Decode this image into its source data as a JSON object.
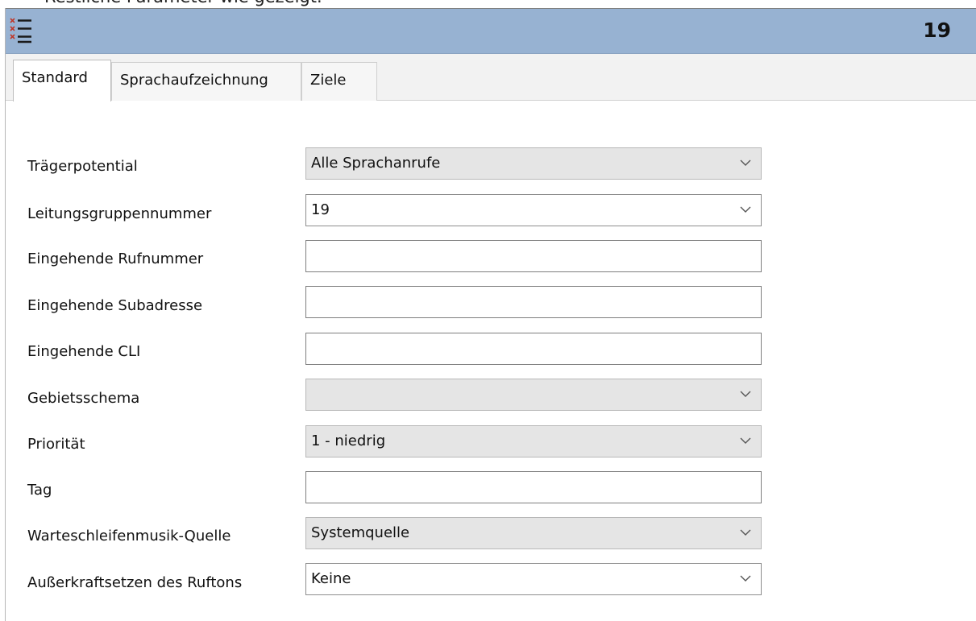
{
  "caption": "Restliche Parameter wie gezeigt.",
  "window": {
    "icon": "list-icon",
    "title_number": "19"
  },
  "tabs": [
    {
      "label": "Standard",
      "active": true
    },
    {
      "label": "Sprachaufzeichnung",
      "active": false
    },
    {
      "label": "Ziele",
      "active": false
    }
  ],
  "form": {
    "traegerpotential": {
      "label": "Trägerpotential",
      "value": "Alle Sprachanrufe"
    },
    "leitungsgruppennummer": {
      "label": "Leitungsgruppennummer",
      "value": "19"
    },
    "eingehende_rufnummer": {
      "label": "Eingehende Rufnummer",
      "value": ""
    },
    "eingehende_subadresse": {
      "label": "Eingehende Subadresse",
      "value": ""
    },
    "eingehende_cli": {
      "label": "Eingehende CLI",
      "value": ""
    },
    "gebietsschema": {
      "label": "Gebietsschema",
      "value": ""
    },
    "prioritaet": {
      "label": "Priorität",
      "value": "1 - niedrig"
    },
    "tag": {
      "label": "Tag",
      "value": ""
    },
    "warteschleifenmusik": {
      "label": "Warteschleifenmusik-Quelle",
      "value": "Systemquelle"
    },
    "ruftons": {
      "label": "Außerkraftsetzen des Ruftons",
      "value": "Keine"
    }
  }
}
